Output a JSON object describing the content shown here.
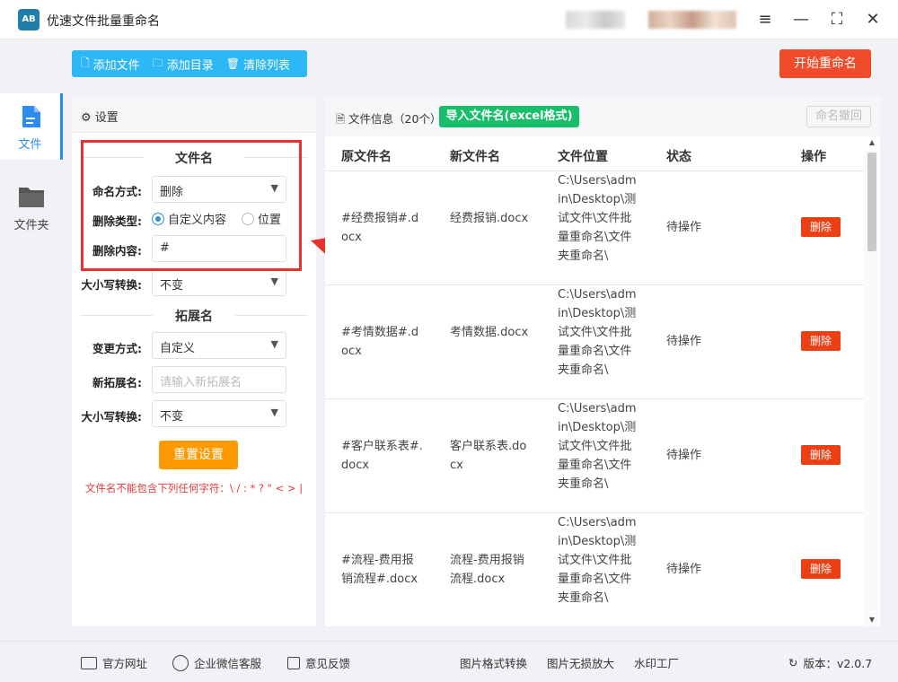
{
  "app": {
    "title": "优速文件批量重命名",
    "logo": "AB"
  },
  "window_controls": [
    "≡",
    "—",
    "⛶",
    "✕"
  ],
  "nav": [
    {
      "label": "文件",
      "icon": "file-icon",
      "active": true
    },
    {
      "label": "文件夹",
      "icon": "folder-icon",
      "active": false
    }
  ],
  "toolbar": {
    "add_file": "添加文件",
    "add_dir": "添加目录",
    "clear_list": "清除列表",
    "start": "开始重命名"
  },
  "settings": {
    "header": "设置",
    "filename_section": "文件名",
    "naming_mode_label": "命名方式:",
    "naming_mode_value": "删除",
    "delete_type_label": "删除类型:",
    "delete_type_opt1": "自定义内容",
    "delete_type_opt2": "位置",
    "delete_content_label": "删除内容:",
    "delete_content_value": "#",
    "case_label": "大小写转换:",
    "case_value": "不变",
    "ext_section": "拓展名",
    "change_mode_label": "变更方式:",
    "change_mode_value": "自定义",
    "new_ext_label": "新拓展名:",
    "new_ext_placeholder": "请输入新拓展名",
    "ext_case_label": "大小写转换:",
    "ext_case_value": "不变",
    "reset": "重置设置",
    "warning": "文件名不能包含下列任何字符：\\ / : * ? \" < > |"
  },
  "file_panel": {
    "info": "文件信息（20个）",
    "import_btn": "导入文件名(excel格式)",
    "undo_btn": "命名撤回",
    "columns": [
      "原文件名",
      "新文件名",
      "文件位置",
      "状态",
      "操作"
    ],
    "rows": [
      {
        "orig": "#经费报销#.docx",
        "new": "经费报销.docx",
        "path": "C:\\Users\\admin\\Desktop\\测试文件\\文件批量重命名\\文件夹重命名\\",
        "status": "待操作",
        "action": "删除"
      },
      {
        "orig": "#考情数据#.docx",
        "new": "考情数据.docx",
        "path": "C:\\Users\\admin\\Desktop\\测试文件\\文件批量重命名\\文件夹重命名\\",
        "status": "待操作",
        "action": "删除"
      },
      {
        "orig": "#客户联系表#.docx",
        "new": "客户联系表.docx",
        "path": "C:\\Users\\admin\\Desktop\\测试文件\\文件批量重命名\\文件夹重命名\\",
        "status": "待操作",
        "action": "删除"
      },
      {
        "orig": "#流程-费用报销流程#.docx",
        "new": "流程-费用报销流程.docx",
        "path": "C:\\Users\\admin\\Desktop\\测试文件\\文件批量重命名\\文件夹重命名\\",
        "status": "待操作",
        "action": "删除"
      }
    ]
  },
  "footer": {
    "website": "官方网址",
    "wechat": "企业微信客服",
    "feedback": "意见反馈",
    "img_convert": "图片格式转换",
    "img_enlarge": "图片无损放大",
    "watermark": "水印工厂",
    "version": "版本：v2.0.7"
  },
  "colors": {
    "primary": "#2d8cf0",
    "toolbar": "#2db7f5",
    "start": "#f04b2a",
    "import": "#19be6b",
    "reset": "#ff9900",
    "delete": "#ed3f14",
    "highlight": "#e8302f"
  }
}
